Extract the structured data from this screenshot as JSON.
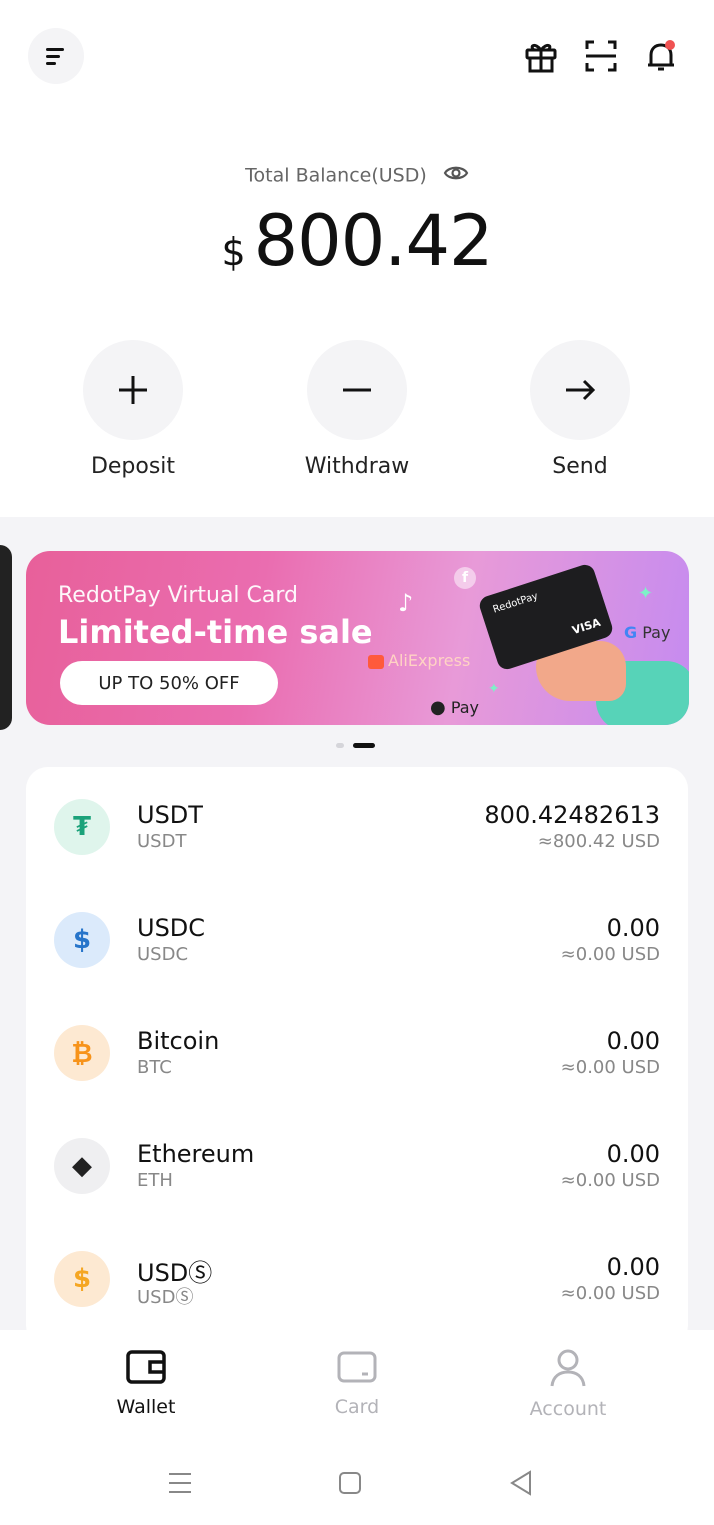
{
  "header": {
    "menu_icon": "menu-icon",
    "gift_icon": "gift-icon",
    "scan_icon": "scan-icon",
    "bell_icon": "bell-icon",
    "notification_dot_color": "#f05252"
  },
  "balance": {
    "label": "Total Balance(USD)",
    "currency_symbol": "$",
    "amount": "800.42"
  },
  "actions": [
    {
      "label": "Deposit",
      "icon": "plus-icon"
    },
    {
      "label": "Withdraw",
      "icon": "minus-icon"
    },
    {
      "label": "Send",
      "icon": "arrow-right-icon"
    }
  ],
  "banner": {
    "subtitle": "RedotPay Virtual Card",
    "title": "Limited-time sale",
    "cta": "UP TO 50% OFF",
    "brands": [
      "AliExpress",
      "Pay",
      "Pay"
    ],
    "card_name": "RedotPay",
    "card_network": "VISA"
  },
  "assets": [
    {
      "name": "USDT",
      "symbol": "USDT",
      "amount": "800.42482613",
      "usd": "≈800.42 USD",
      "color": "#1ba27a",
      "bg": "#dff5ec",
      "glyph": "₮"
    },
    {
      "name": "USDC",
      "symbol": "USDC",
      "amount": "0.00",
      "usd": "≈0.00 USD",
      "color": "#2775ca",
      "bg": "#dbeafb",
      "glyph": "$"
    },
    {
      "name": "Bitcoin",
      "symbol": "BTC",
      "amount": "0.00",
      "usd": "≈0.00 USD",
      "color": "#f7931a",
      "bg": "#fde9d2",
      "glyph": "₿"
    },
    {
      "name": "Ethereum",
      "symbol": "ETH",
      "amount": "0.00",
      "usd": "≈0.00 USD",
      "color": "#222222",
      "bg": "#efeff1",
      "glyph": "◆"
    },
    {
      "name": "USDⓈ",
      "symbol": "USDⓈ",
      "amount": "0.00",
      "usd": "≈0.00 USD",
      "color": "#f5a623",
      "bg": "#fde9d2",
      "glyph": "$"
    }
  ],
  "tabs": [
    {
      "label": "Wallet",
      "active": true
    },
    {
      "label": "Card",
      "active": false
    },
    {
      "label": "Account",
      "active": false
    }
  ]
}
